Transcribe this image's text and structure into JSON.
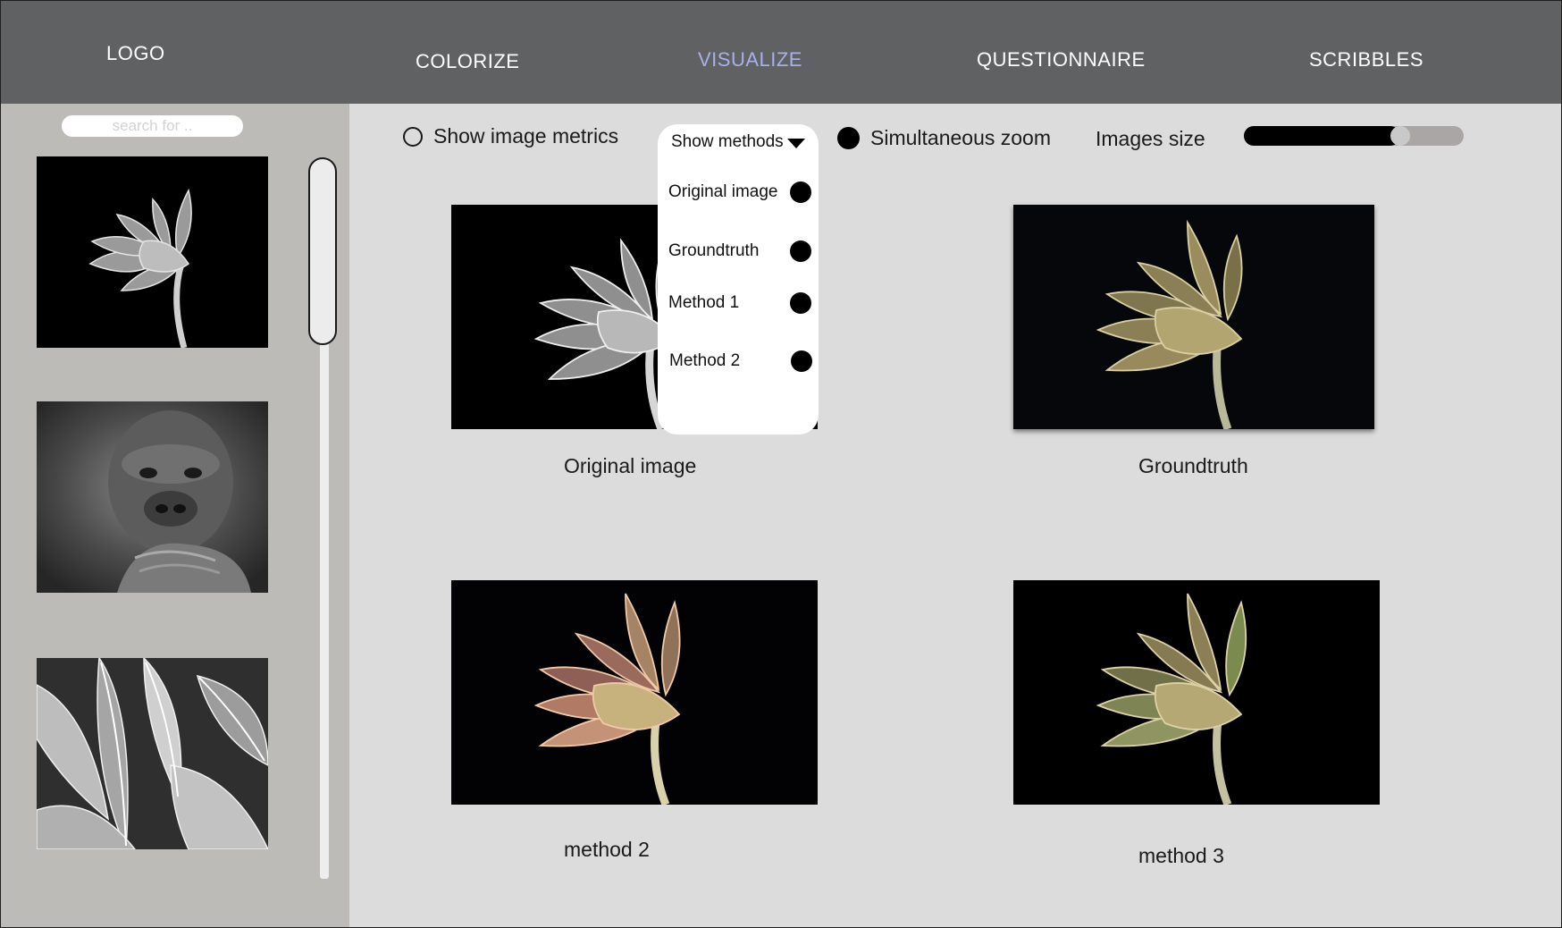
{
  "nav": {
    "logo": "LOGO",
    "items": [
      {
        "label": "COLORIZE",
        "active": false
      },
      {
        "label": "VISUALIZE",
        "active": true
      },
      {
        "label": "QUESTIONNAIRE",
        "active": false
      },
      {
        "label": "SCRIBBLES",
        "active": false
      }
    ],
    "active_color": "#a7b1e7"
  },
  "sidebar": {
    "search_placeholder": "search for ..",
    "thumbnails": [
      {
        "subject": "lotus flower (grayscale)"
      },
      {
        "subject": "gorilla (grayscale)"
      },
      {
        "subject": "banana leaves (grayscale)"
      }
    ]
  },
  "toolbar": {
    "show_metrics_label": "Show image metrics",
    "show_metrics_checked": false,
    "show_methods_label": "Show methods",
    "methods_options": [
      {
        "label": "Original image",
        "selected": true
      },
      {
        "label": "Groundtruth",
        "selected": true
      },
      {
        "label": "Method 1",
        "selected": true
      },
      {
        "label": "Method 2",
        "selected": true
      }
    ],
    "simultaneous_zoom_label": "Simultaneous zoom",
    "simultaneous_zoom_checked": true,
    "images_size_label": "Images size",
    "images_size_value": 0.71
  },
  "gallery": [
    {
      "caption": "Original image"
    },
    {
      "caption": "Groundtruth"
    },
    {
      "caption": "method 2"
    },
    {
      "caption": "method 3"
    }
  ],
  "colors": {
    "topbar": "#5f6163",
    "sidebar": "#bcbbb7",
    "main_bg": "#dcdcdc"
  }
}
